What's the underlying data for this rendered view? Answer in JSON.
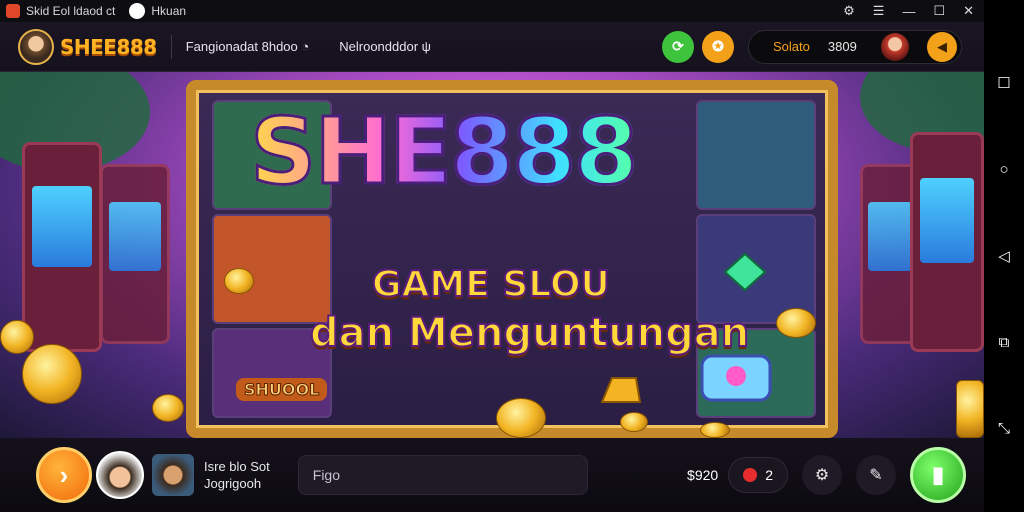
{
  "window": {
    "title": "Skid Eol ldaod ct",
    "title2": "Hkuan",
    "controls": [
      "⚙",
      "☰",
      "—",
      "☐",
      "✕"
    ]
  },
  "header": {
    "brand": "SHEE888",
    "menu1": "Fangionadat 8hdoo",
    "menu1_icon": "◔",
    "menu2": "Nelroondddor",
    "menu2_icon": "ψ",
    "pill_label": "Solato",
    "pill_value": "3809"
  },
  "banner": {
    "title": "SHE888",
    "subtitle1": "GAME SLOU",
    "subtitle2": "dan Menguntungan",
    "char_logo": "SHUOOL"
  },
  "bottom": {
    "game_title": "Isre blo Sot",
    "game_sub": "Jogrigooh",
    "search_placeholder": "Figo",
    "balance": "$920",
    "counter": "2"
  }
}
